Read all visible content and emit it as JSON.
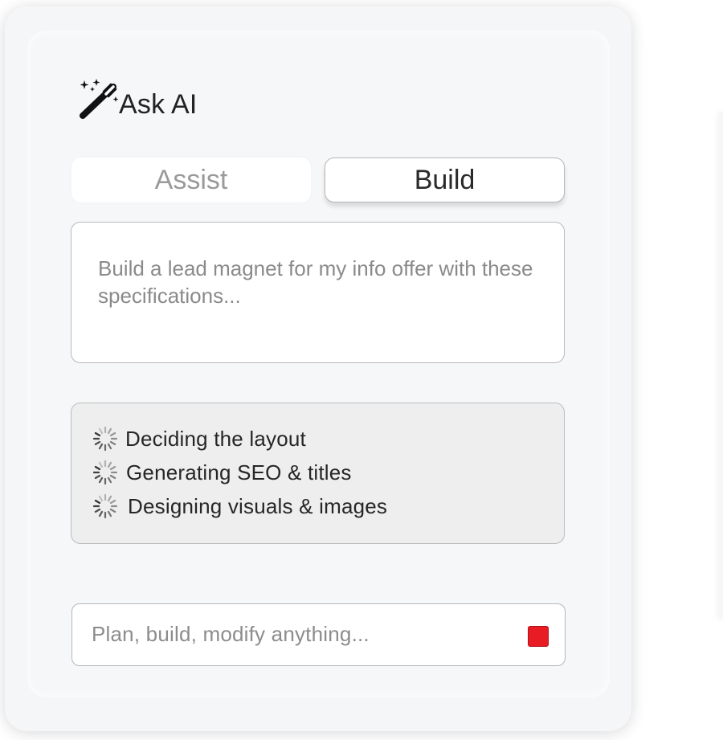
{
  "header": {
    "icon": "magic-wand-icon",
    "title": "Ask AI"
  },
  "tabs": [
    {
      "label": "Assist",
      "active": false
    },
    {
      "label": "Build",
      "active": true
    }
  ],
  "prompt": {
    "text": "Build a lead magnet for my info offer with these specifications..."
  },
  "progress": {
    "steps": [
      {
        "icon": "loading-spinner-icon",
        "label": "Deciding the layout"
      },
      {
        "icon": "loading-spinner-icon",
        "label": "Generating SEO & titles"
      },
      {
        "icon": "loading-spinner-icon",
        "label": "Designing visuals & images"
      }
    ]
  },
  "chat_input": {
    "placeholder": "Plan, build, modify anything...",
    "stop_icon": "stop-square-icon",
    "stop_color": "#e81c24"
  },
  "colors": {
    "card_background": "#f5f6f8",
    "progress_background": "#eeeeee",
    "inactive_tab_text": "#9a9a9a",
    "active_tab_text": "#2a2a2a"
  }
}
